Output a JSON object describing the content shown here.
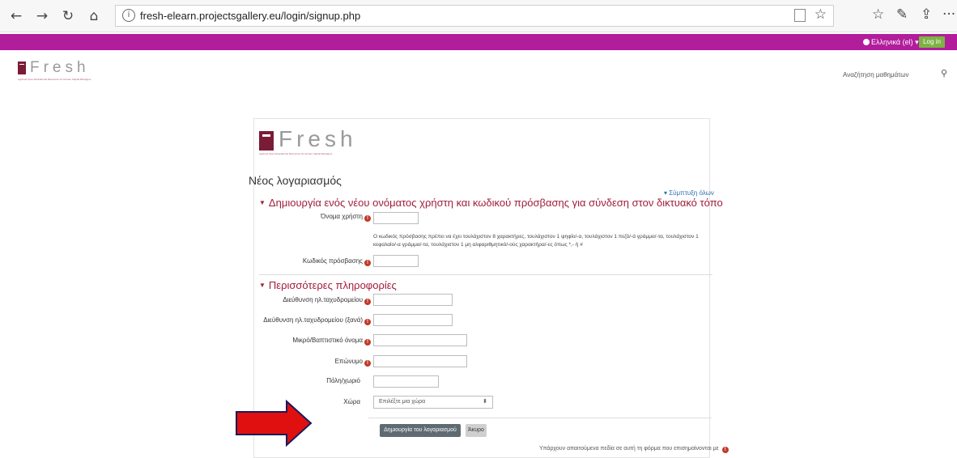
{
  "browser": {
    "url": "fresh-elearn.projectsgallery.eu/login/signup.php",
    "back_icon": "←",
    "forward_icon": "→",
    "reload_icon": "↻",
    "home_icon": "⌂",
    "info_icon": "i",
    "star_icon": "☆",
    "favorites_icon": "☆",
    "pen_icon": "✎",
    "share_icon": "⇪",
    "more_icon": "···"
  },
  "topbar": {
    "language": "Ελληνικά (el) ▾",
    "login_label": "Log in",
    "color": "#b21d9c"
  },
  "header": {
    "logo_text": "Fresh",
    "logo_tagline": "Agrifood Open Educational Resources for Human Capital Managers",
    "search_label": "Αναζήτηση μαθημάτων",
    "search_icon": "⚲"
  },
  "form": {
    "logo_text": "Fresh",
    "logo_tagline": "Agrifood Open Educational Resources for Human Capital Managers",
    "title": "Νέος λογαριασμός",
    "collapse_all": "▾ Σύμπτυξη όλων",
    "section1": {
      "title": "Δημιουργία ενός νέου ονόματος χρήστη και κωδικού πρόσβασης για σύνδεση στον δικτυακό τόπο",
      "username_label": "Όνομα χρήστη",
      "password_hint": "Ο κωδικός πρόσβασης πρέπει να έχει τουλάχιστον 8 χαρακτήρες, τουλάχιστον 1 ψηφίο/-α, τουλάχιστον 1 πεζό/-ά γράμμα/-τα, τουλάχιστον 1 κεφαλαίο/-α γράμμα/-τα, τουλάχιστον 1 μη αλφαριθμητικό/-ούς χαρακτήρα/-ες όπως *,- ή #",
      "password_label": "Κωδικός πρόσβασης"
    },
    "section2": {
      "title": "Περισσότερες πληροφορίες",
      "email_label": "Διεύθυνση ηλ.ταχυδρομείου",
      "email2_label": "Διεύθυνση ηλ.ταχυδρομείου (ξανά)",
      "firstname_label": "Μικρό/Βαπτιστικό όνομα",
      "lastname_label": "Επώνυμο",
      "city_label": "Πόλη/χωριό",
      "country_label": "Χώρα",
      "country_value": "Επιλέξτε μια χώρα",
      "country_arrow": "⬍"
    },
    "submit_label": "Δημιουργία του λογαριασμού μου",
    "cancel_label": "Άκυρο",
    "required_note": "Υπάρχουν απαιτούμενα πεδία σε αυτή τη φόρμα που επισημαίνονται με",
    "required_mark": "!"
  },
  "colors": {
    "accent": "#a11d3a",
    "arrow": "#e01010",
    "login": "#7cb342"
  }
}
